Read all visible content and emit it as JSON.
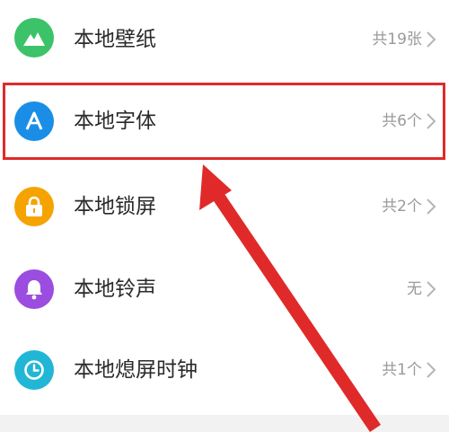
{
  "colors": {
    "wallpaper": "#3cc268",
    "font": "#1a8ee6",
    "lock": "#f5a300",
    "ringtone": "#9b4de0",
    "clock": "#21b6d6",
    "highlight": "#e02a2a"
  },
  "items": [
    {
      "label": "本地壁纸",
      "count": "共19张",
      "icon": "mountain-icon"
    },
    {
      "label": "本地字体",
      "count": "共6个",
      "icon": "font-a-icon"
    },
    {
      "label": "本地锁屏",
      "count": "共2个",
      "icon": "lock-icon"
    },
    {
      "label": "本地铃声",
      "count": "无",
      "icon": "bell-icon"
    },
    {
      "label": "本地熄屏时钟",
      "count": "共1个",
      "icon": "clock-icon"
    }
  ]
}
